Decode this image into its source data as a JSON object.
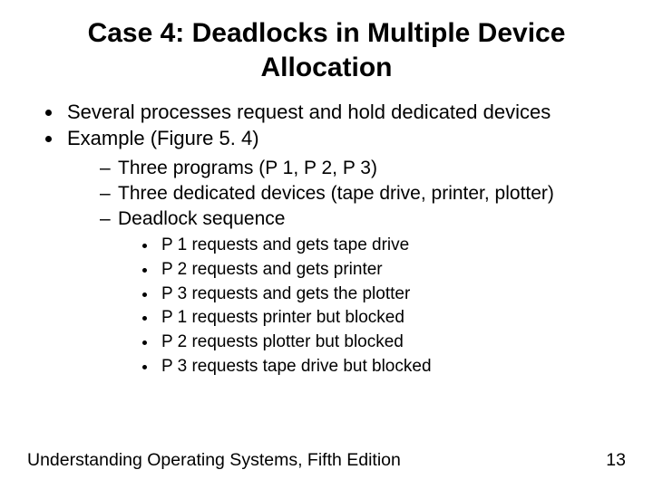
{
  "title": "Case 4: Deadlocks in Multiple Device Allocation",
  "bullets_l1": [
    "Several processes request and hold dedicated devices",
    "Example (Figure 5. 4)"
  ],
  "bullets_l2": [
    "Three programs (P 1, P 2, P 3)",
    "Three dedicated devices (tape drive, printer, plotter)",
    "Deadlock sequence"
  ],
  "bullets_l3": [
    "P 1 requests and gets tape drive",
    "P 2 requests and gets printer",
    "P 3 requests and gets the plotter",
    "P 1 requests printer but blocked",
    "P 2 requests plotter but blocked",
    "P 3 requests tape drive but blocked"
  ],
  "footer_text": "Understanding Operating Systems, Fifth Edition",
  "page_number": "13"
}
